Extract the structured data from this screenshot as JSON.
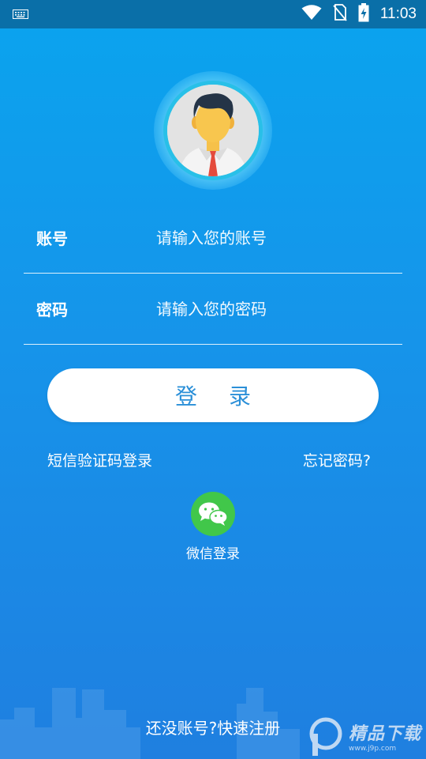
{
  "status_bar": {
    "time": "11:03",
    "icons": [
      "keyboard-icon",
      "wifi-icon",
      "no-sim-icon",
      "battery-charging-icon"
    ]
  },
  "form": {
    "account": {
      "label": "账号",
      "placeholder": "请输入您的账号",
      "value": ""
    },
    "password": {
      "label": "密码",
      "placeholder": "请输入您的密码",
      "value": ""
    }
  },
  "login_button": "登录",
  "sms_login": "短信验证码登录",
  "forgot_password": "忘记密码?",
  "wechat_login": "微信登录",
  "register": "还没账号?快速注册",
  "watermark": {
    "brand": "精品下载",
    "url": "www.j9p.com"
  },
  "colors": {
    "bg_top": "#0aa4ee",
    "bg_bottom": "#1f7fe0",
    "status_bar": "#0a6fa8",
    "button_text": "#2a8fd8",
    "wechat_green": "#41c74a"
  }
}
